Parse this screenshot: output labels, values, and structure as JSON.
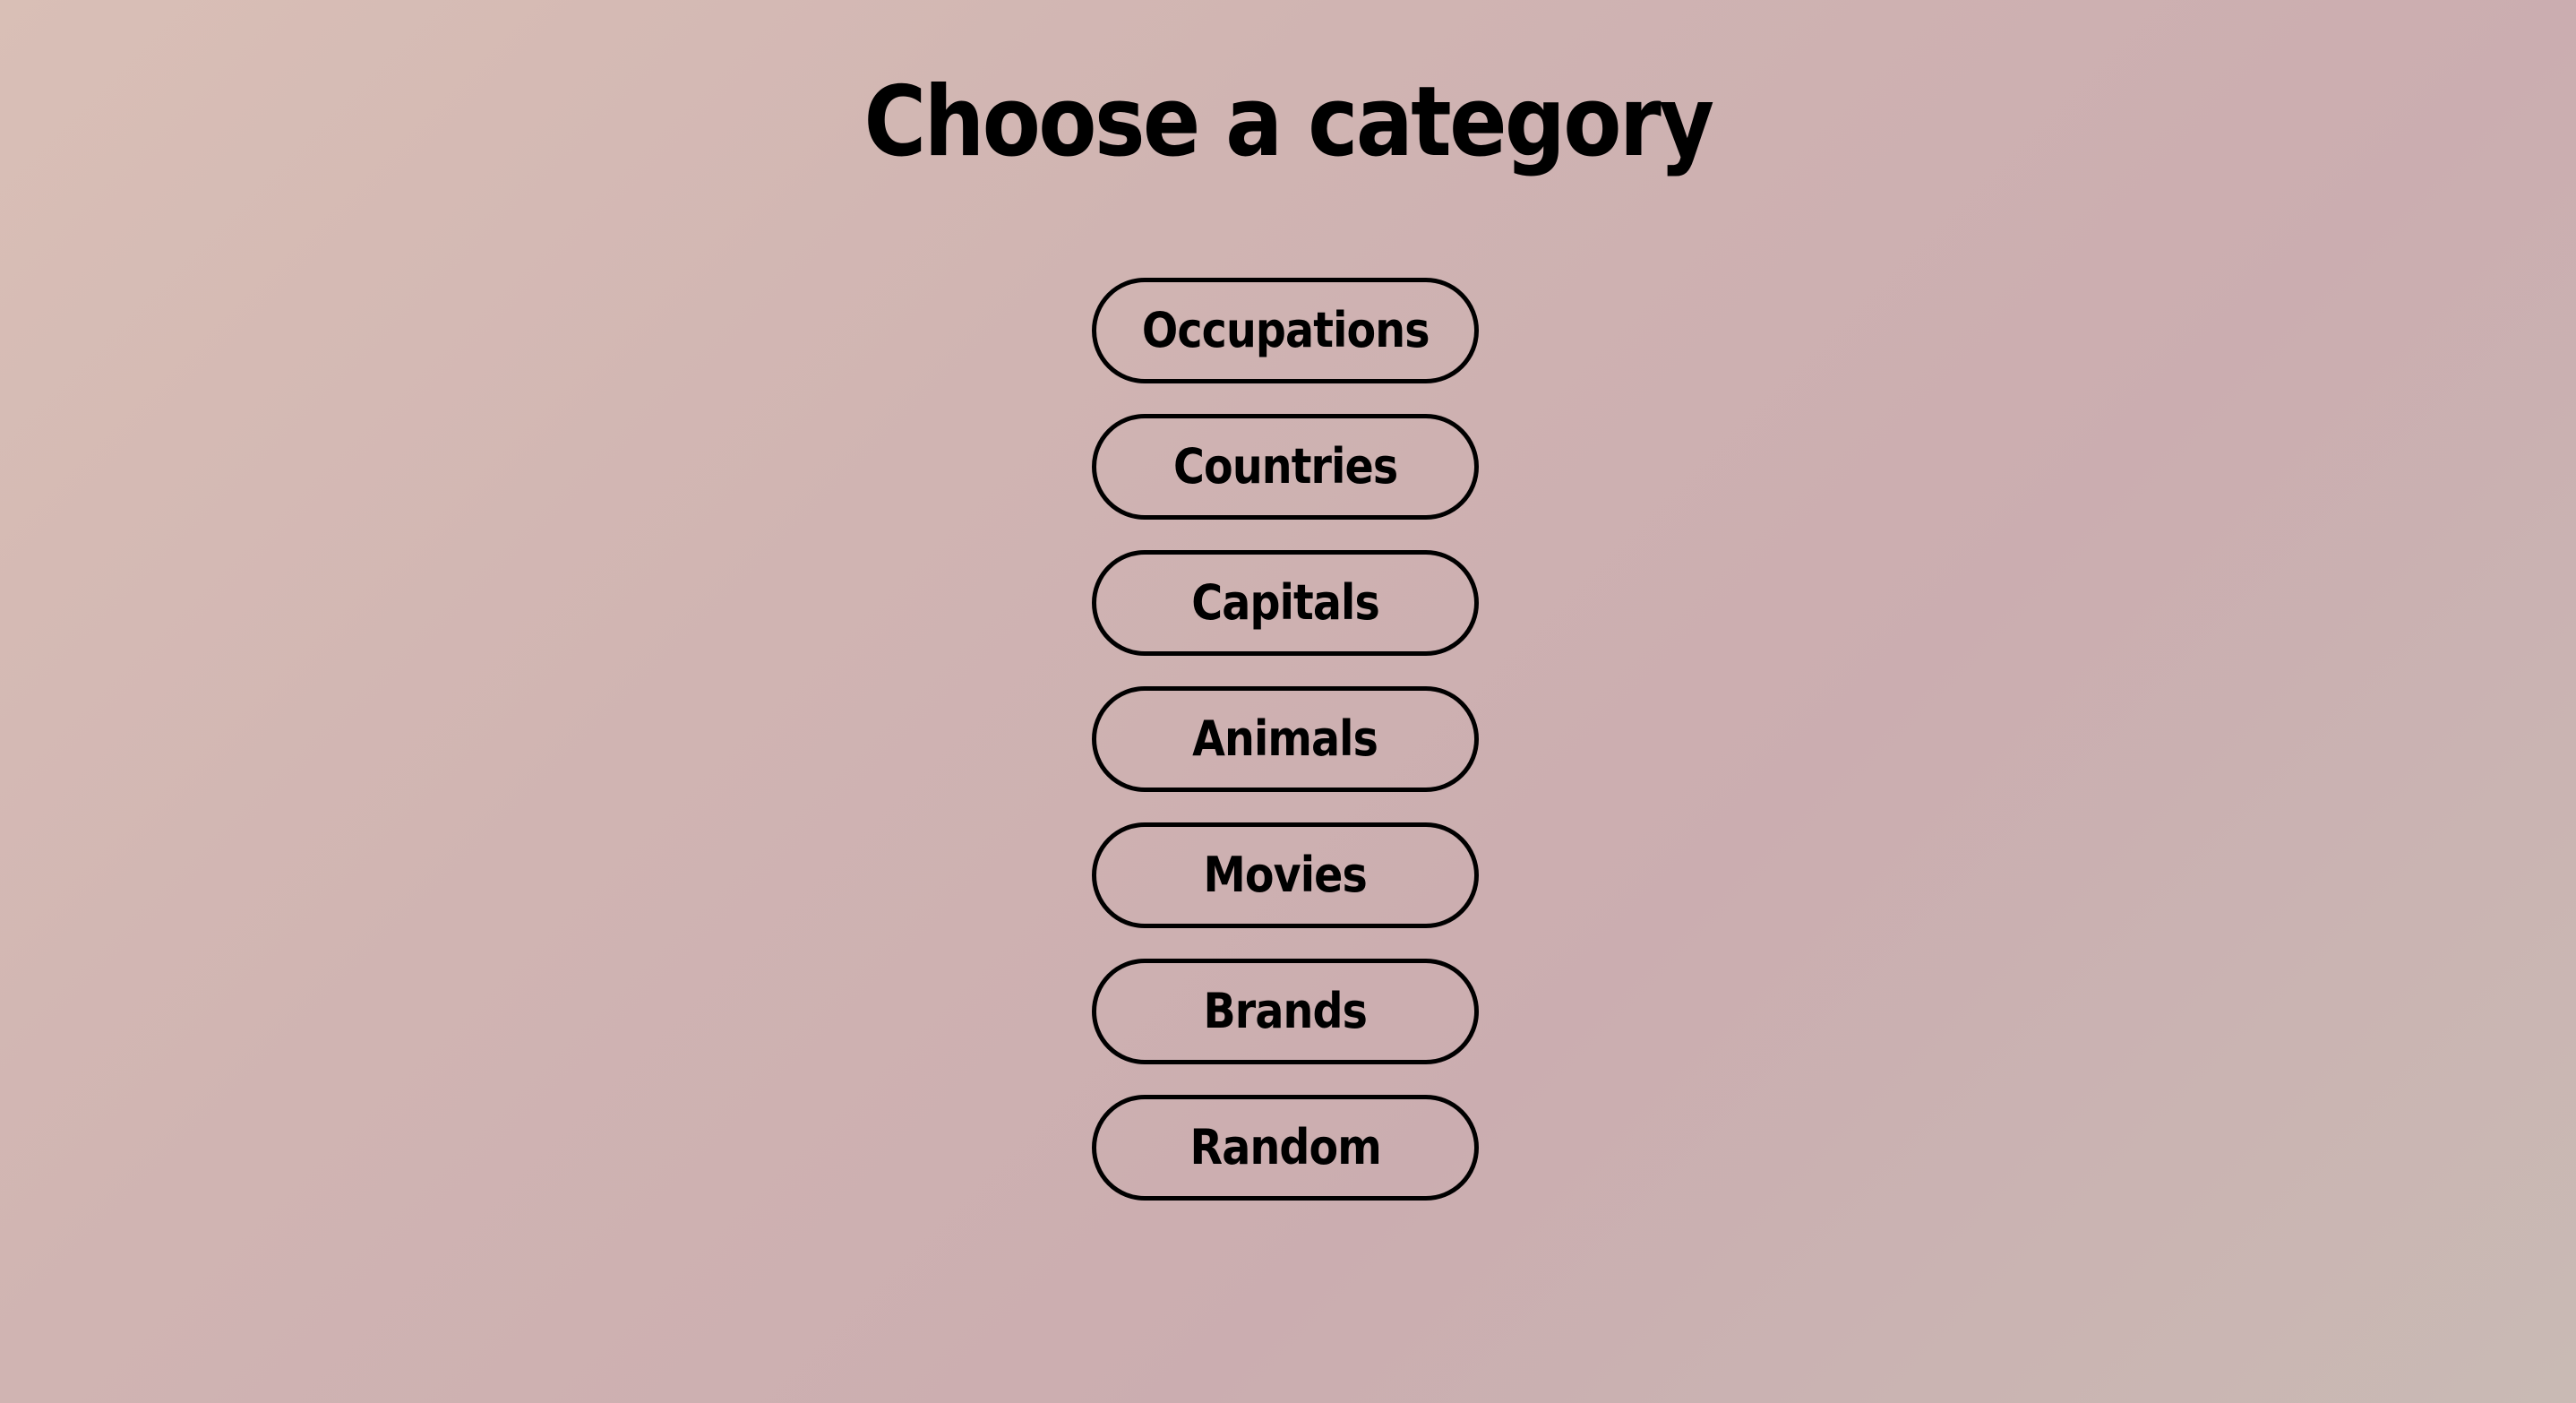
{
  "page": {
    "title": "Choose a category"
  },
  "categories": [
    {
      "label": "Occupations"
    },
    {
      "label": "Countries"
    },
    {
      "label": "Capitals"
    },
    {
      "label": "Animals"
    },
    {
      "label": "Movies"
    },
    {
      "label": "Brands"
    },
    {
      "label": "Random"
    }
  ],
  "colors": {
    "background_start": "#d9bfb6",
    "background_end": "#c9bab4",
    "text": "#000000",
    "button_border": "#000000"
  }
}
